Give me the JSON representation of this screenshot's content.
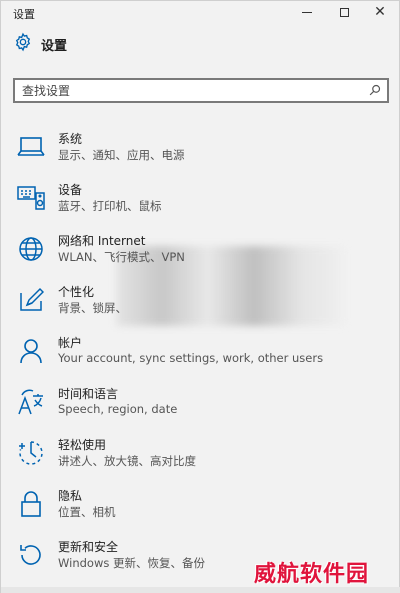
{
  "window": {
    "title": "设置",
    "minimize": "minimize",
    "maximize": "maximize",
    "close": "close"
  },
  "header": {
    "label": "设置",
    "icon": "gear-icon"
  },
  "search": {
    "placeholder": "查找设置",
    "value": "",
    "icon": "search-icon"
  },
  "items": [
    {
      "name": "系统",
      "desc": "显示、通知、应用、电源",
      "icon": "laptop-icon"
    },
    {
      "name": "设备",
      "desc": "蓝牙、打印机、鼠标",
      "icon": "keyboard-speaker-icon"
    },
    {
      "name": "网络和 Internet",
      "desc": "WLAN、飞行模式、VPN",
      "icon": "globe-icon"
    },
    {
      "name": "个性化",
      "desc": "背景、锁屏、",
      "icon": "pen-display-icon"
    },
    {
      "name": "帐户",
      "desc": "Your account, sync settings, work, other users",
      "icon": "person-icon"
    },
    {
      "name": "时间和语言",
      "desc": "Speech, region, date",
      "icon": "language-time-icon"
    },
    {
      "name": "轻松使用",
      "desc": "讲述人、放大镜、高对比度",
      "icon": "ease-of-access-icon"
    },
    {
      "name": "隐私",
      "desc": "位置、相机",
      "icon": "lock-icon"
    },
    {
      "name": "更新和安全",
      "desc": "Windows 更新、恢复、备份",
      "icon": "refresh-icon"
    }
  ],
  "watermark": "威航软件园",
  "colors": {
    "accent": "#0063b1",
    "background": "#f2f2f2",
    "watermark": "#e0143c"
  }
}
